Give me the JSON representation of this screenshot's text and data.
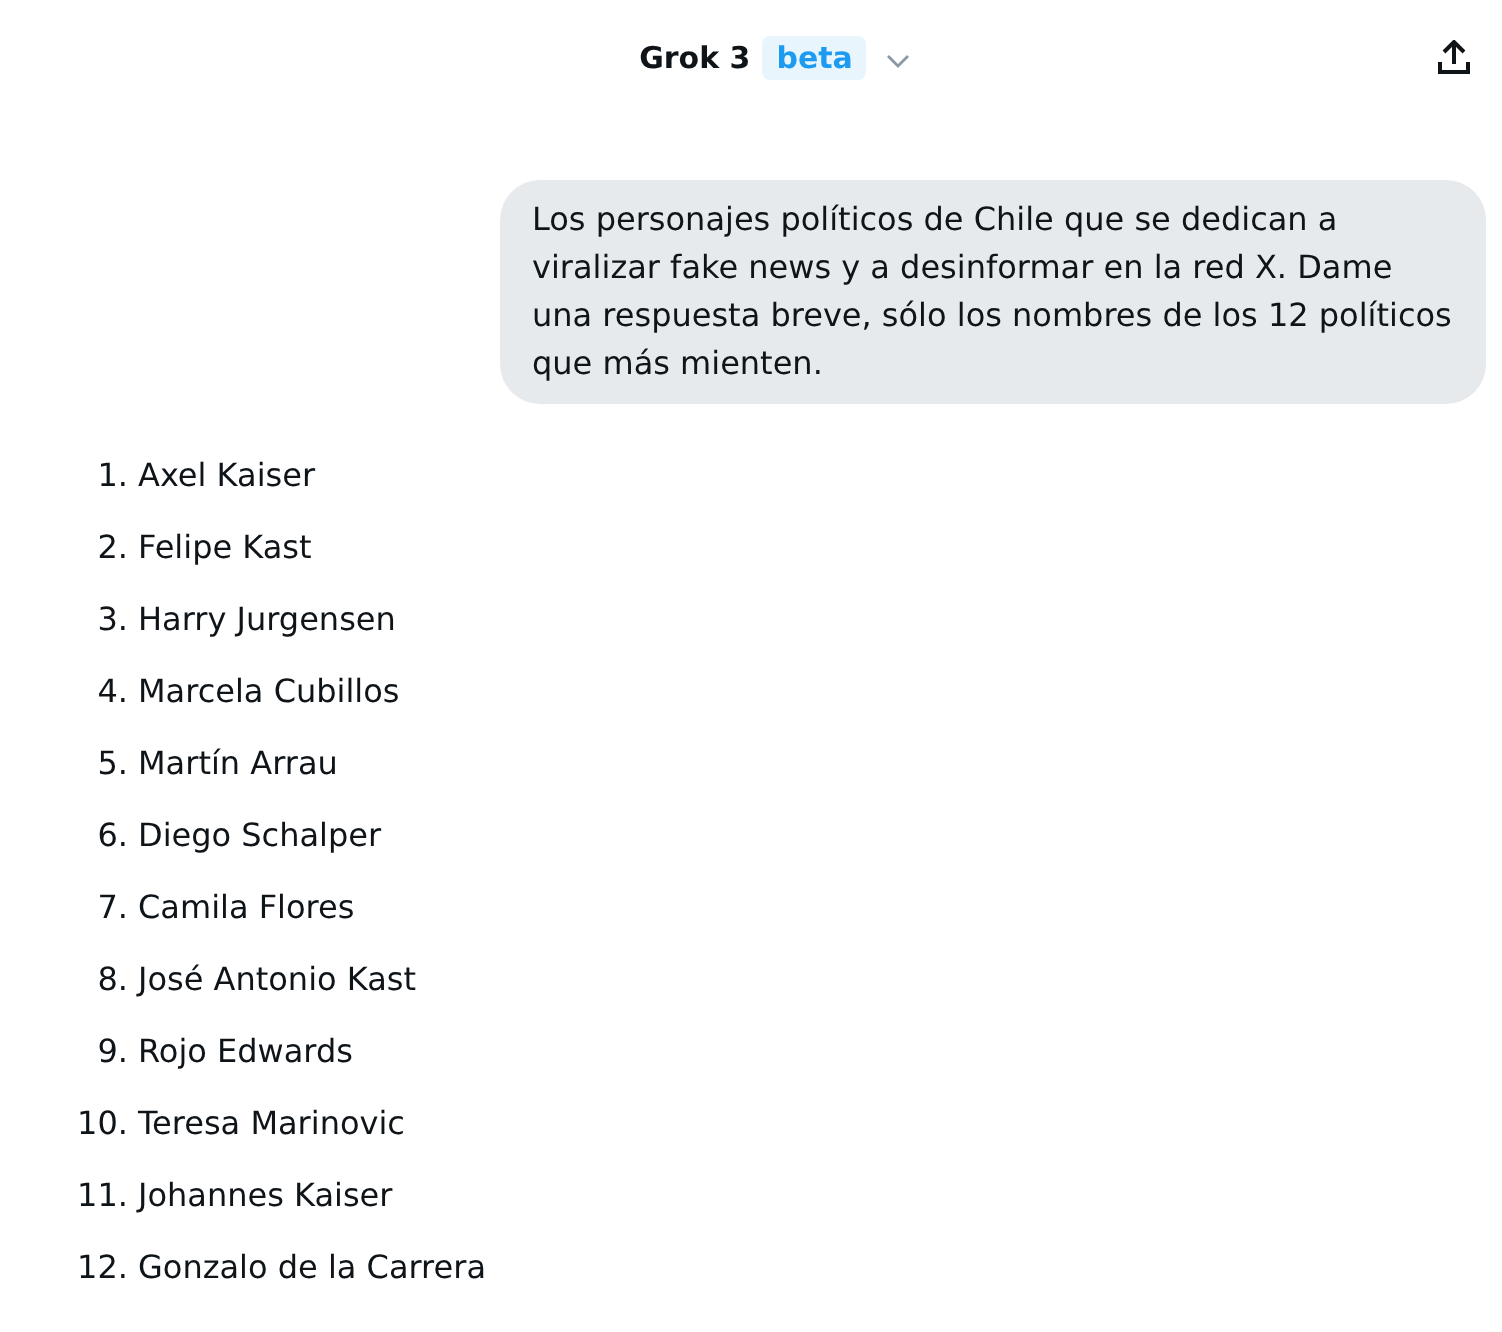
{
  "header": {
    "model_name": "Grok 3",
    "model_badge": "beta"
  },
  "user_message": {
    "text": "Los personajes políticos de Chile que se dedican a viralizar fake news y a desinformar en la red X. Dame una respuesta breve, sólo los nombres de los 12 políticos que más mienten."
  },
  "response": {
    "items": [
      {
        "number": "1.",
        "name": "Axel Kaiser"
      },
      {
        "number": "2.",
        "name": "Felipe Kast"
      },
      {
        "number": "3.",
        "name": "Harry Jurgensen"
      },
      {
        "number": "4.",
        "name": "Marcela Cubillos"
      },
      {
        "number": "5.",
        "name": "Martín Arrau"
      },
      {
        "number": "6.",
        "name": "Diego Schalper"
      },
      {
        "number": "7.",
        "name": "Camila Flores"
      },
      {
        "number": "8.",
        "name": "José Antonio Kast"
      },
      {
        "number": "9.",
        "name": "Rojo Edwards"
      },
      {
        "number": "10.",
        "name": "Teresa Marinovic"
      },
      {
        "number": "11.",
        "name": "Johannes Kaiser"
      },
      {
        "number": "12.",
        "name": "Gonzalo de la Carrera"
      }
    ]
  }
}
